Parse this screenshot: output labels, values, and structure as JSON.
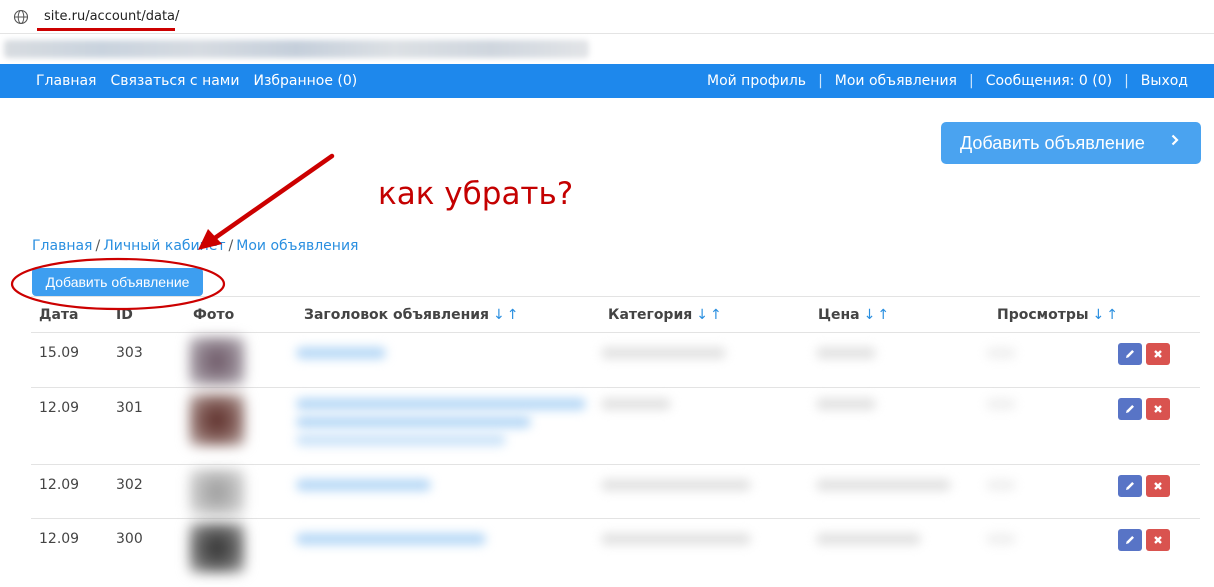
{
  "browser": {
    "url": "site.ru/account/data/"
  },
  "navbar": {
    "left": [
      "Главная",
      "Связаться с нами",
      "Избранное (0)"
    ],
    "right": [
      "Мой профиль",
      "Мои объявления",
      "Сообщения: 0 (0)",
      "Выход"
    ],
    "color": "#1e88ec"
  },
  "header": {
    "add_button_label": "Добавить объявление"
  },
  "annotation": {
    "text": "как убрать?",
    "color": "#c40000"
  },
  "breadcrumb": {
    "items": [
      "Главная",
      "Личный кабинет",
      "Мои объявления"
    ],
    "separator": "/"
  },
  "actions": {
    "add_button_label": "Добавить объявление"
  },
  "table": {
    "headers": {
      "date": "Дата",
      "id": "ID",
      "photo": "Фото",
      "title": "Заголовок объявления",
      "category": "Категория",
      "price": "Цена",
      "views": "Просмотры"
    },
    "sort_down": "↓",
    "sort_up": "↑",
    "rows": [
      {
        "date": "15.09",
        "id": "303"
      },
      {
        "date": "12.09",
        "id": "301"
      },
      {
        "date": "12.09",
        "id": "302"
      },
      {
        "date": "12.09",
        "id": "300"
      }
    ]
  },
  "icons": {
    "edit": "pencil-icon",
    "delete": "close-icon",
    "address": "globe-icon",
    "chevron": "chevron-right-icon"
  }
}
